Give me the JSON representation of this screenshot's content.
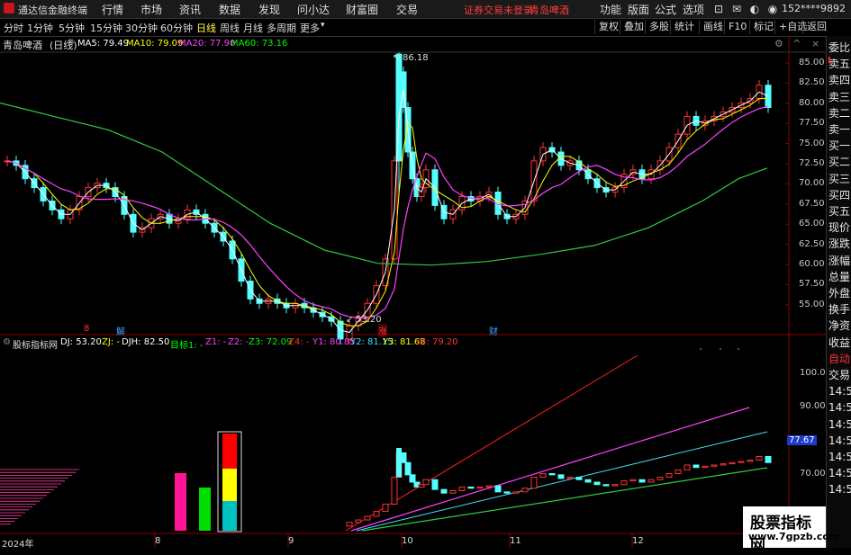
{
  "app": {
    "title": "通达信金融终端",
    "menu": [
      "行情",
      "市场",
      "资讯",
      "数据",
      "发现",
      "问小达",
      "财富圈",
      "交易"
    ],
    "notice": "证券交易未登录",
    "stock_link": "青岛啤酒",
    "right_menu": [
      "功能",
      "版面",
      "公式",
      "选项"
    ],
    "user": "152****9892"
  },
  "toolbar": {
    "periods": [
      "分时",
      "1分钟",
      "5分钟",
      "15分钟",
      "30分钟",
      "60分钟",
      "日线",
      "周线",
      "月线",
      "多周期",
      "更多"
    ],
    "active_period": "日线",
    "right": [
      "复权",
      "叠加",
      "多股",
      "统计",
      "画线",
      "F10",
      "标记",
      "+自选",
      "返回"
    ]
  },
  "price_chart": {
    "stock": "青岛啤酒",
    "period": "(日线)",
    "ma": [
      {
        "label": "MA5: 79.49",
        "color": "#ffffff"
      },
      {
        "label": "MA10: 79.09",
        "color": "#ffff00"
      },
      {
        "label": "MA20: 77.90",
        "color": "#ff40ff"
      },
      {
        "label": "MA60: 73.16",
        "color": "#00ff00"
      }
    ],
    "y_ticks": [
      "85.00",
      "82.50",
      "80.00",
      "77.50",
      "75.00",
      "72.50",
      "70.00",
      "67.50",
      "65.00",
      "62.50",
      "60.00",
      "57.50",
      "55.00"
    ],
    "high_label": "86.18",
    "low_label": "53.20",
    "events": [
      {
        "text": "8",
        "color": "#ff3030"
      },
      {
        "text": "解",
        "color": "#40a0ff"
      },
      {
        "text": "涨",
        "color": "#ff3030"
      },
      {
        "text": "财",
        "color": "#40a0ff"
      }
    ]
  },
  "indicator": {
    "name": "股标指标网",
    "items": [
      {
        "label": "DJ: 53.20",
        "color": "#ffffff"
      },
      {
        "label": "ZJ: -",
        "color": "#ffff00"
      },
      {
        "label": "DJH: 82.50",
        "color": "#ffffff"
      },
      {
        "label": "目标1: -",
        "color": "#00ff00"
      },
      {
        "label": "Z1: -",
        "color": "#ff40ff"
      },
      {
        "label": "Z2: -",
        "color": "#ff40ff"
      },
      {
        "label": "Z3: 72.09",
        "color": "#00ff00"
      },
      {
        "label": "Z4: -",
        "color": "#ff3030"
      },
      {
        "label": "Y1: 80.85",
        "color": "#ff40ff"
      },
      {
        "label": "Y2: 81.15",
        "color": "#40e0ff"
      },
      {
        "label": "Y3: 81.68",
        "color": "#ffff00"
      },
      {
        "label": "Y4: 79.20",
        "color": "#ff3030"
      }
    ],
    "y_ticks": [
      "100.0",
      "90.00",
      "77.67",
      "70.00"
    ],
    "current_value": "77.67"
  },
  "x_axis": [
    "2024年",
    "8",
    "9",
    "10",
    "11",
    "12"
  ],
  "right_strip": [
    "委比",
    "卖五",
    "卖四",
    "卖三",
    "卖二",
    "卖一",
    "买一",
    "买二",
    "买三",
    "买四",
    "买五",
    "现价",
    "涨跌",
    "涨幅",
    "总量",
    "外盘",
    "换手",
    "净资",
    "收益",
    "自动",
    "交易",
    "14:56",
    "14:56",
    "14:56",
    "14:56",
    "14:56",
    "14:56",
    "14:56"
  ],
  "watermark": {
    "line1": "股票指标网",
    "line2": "www.7gpzb.com"
  }
}
